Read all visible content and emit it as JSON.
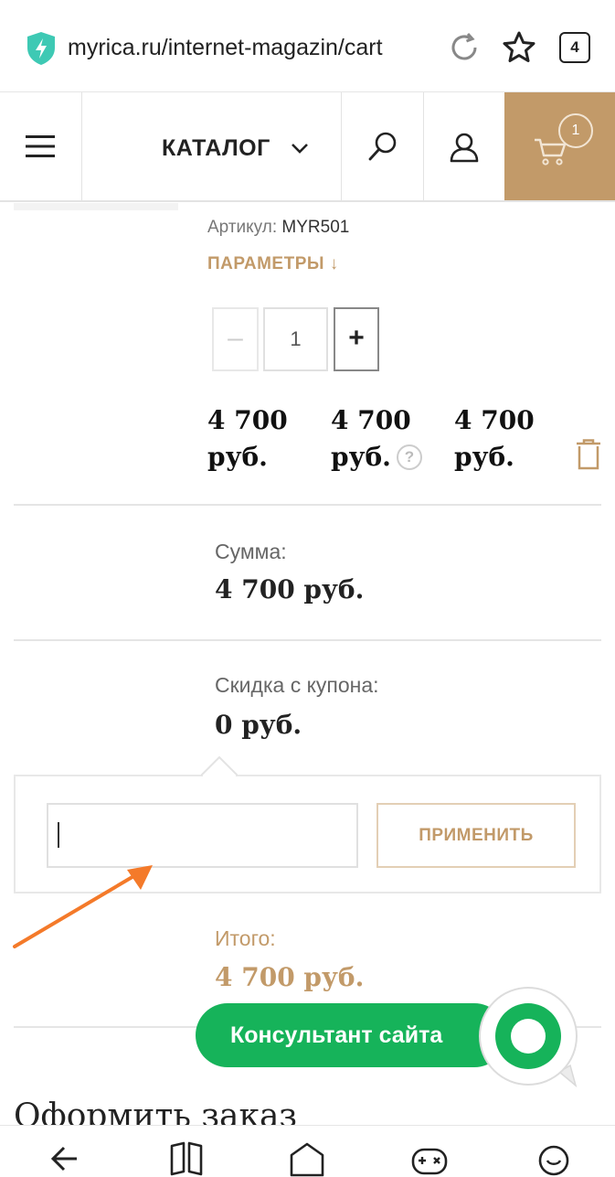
{
  "browser": {
    "url": "myrica.ru/internet-magazin/cart",
    "tab_count": "4"
  },
  "header": {
    "catalog_label": "КАТАЛОГ",
    "cart_count": "1",
    "accent_color": "#c29a69"
  },
  "product": {
    "sku_label": "Артикул:",
    "sku_value": "MYR501",
    "params_label": "ПАРАМЕТРЫ ↓",
    "quantity": "1",
    "minus_label": "–",
    "plus_label": "+",
    "price_1": "4 700 руб.",
    "price_2": "4 700 руб.",
    "price_3": "4 700 руб.",
    "help_label": "?"
  },
  "summary": {
    "sum_label": "Сумма:",
    "sum_value": "4 700 руб.",
    "discount_label": "Скидка с купона:",
    "discount_value": "0 руб.",
    "total_label": "Итого:",
    "total_value": "4 700 руб."
  },
  "coupon": {
    "input_value": "",
    "apply_label": "ПРИМЕНИТЬ"
  },
  "consultant": {
    "label": "Консультант сайта",
    "color": "#16b35a"
  },
  "checkout": {
    "title": "Оформить заказ"
  }
}
